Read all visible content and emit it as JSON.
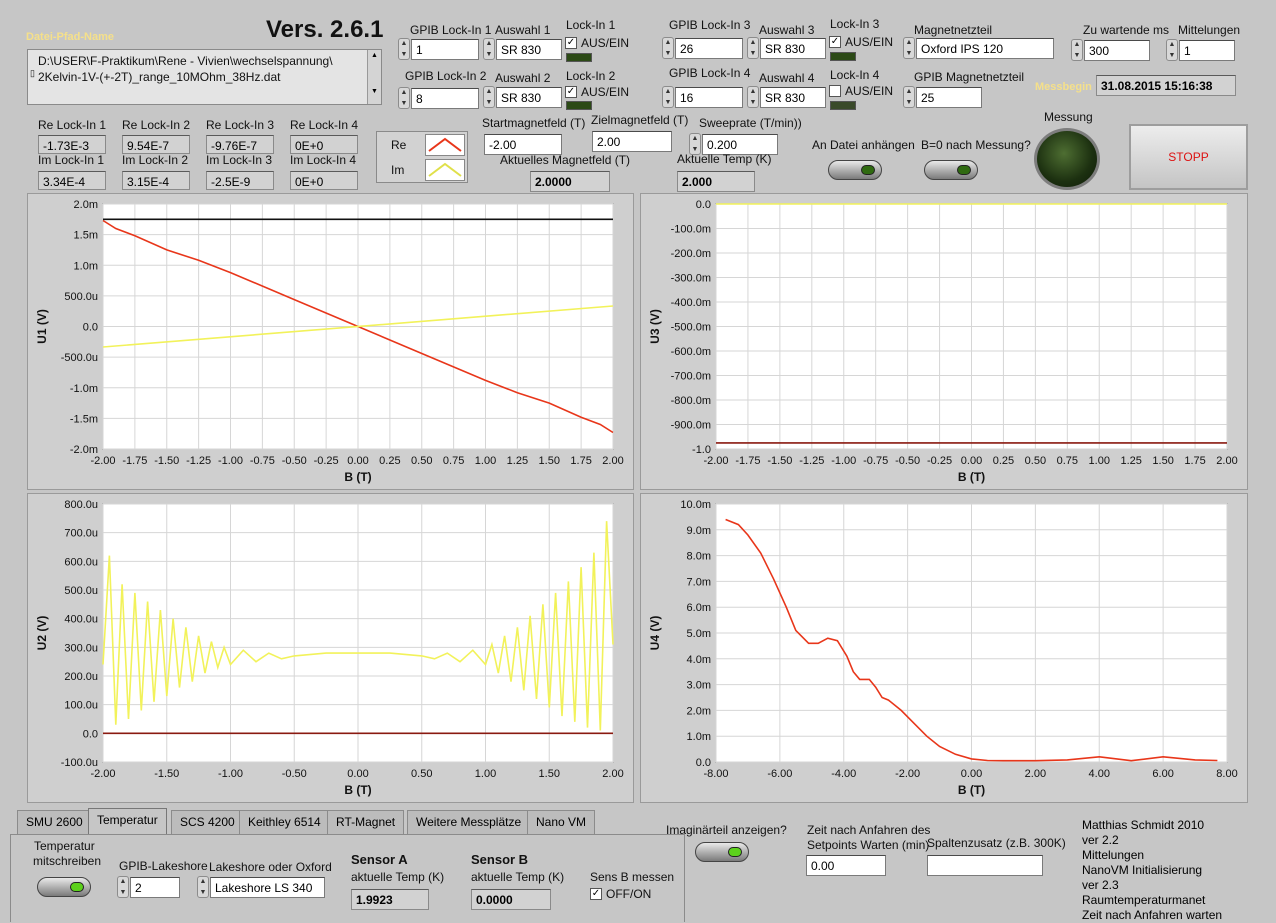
{
  "header": {
    "file_path_label": "Datei-Pfad-Name",
    "version": "Vers. 2.6.1",
    "file_path_line1": "D:\\USER\\F-Praktikum\\Rene - Vivien\\wechselspannung\\",
    "file_path_line2": "2Kelvin-1V-(+-2T)_range_10MOhm_38Hz.dat"
  },
  "lockins": [
    {
      "gpib_label": "GPIB Lock-In 1",
      "gpib": "1",
      "auswahl_label": "Auswahl 1",
      "auswahl": "SR 830",
      "switch_label": "Lock-In 1",
      "switch_text": "AUS/EIN",
      "checked": true
    },
    {
      "gpib_label": "GPIB Lock-In 2",
      "gpib": "8",
      "auswahl_label": "Auswahl 2",
      "auswahl": "SR 830",
      "switch_label": "Lock-In 2",
      "switch_text": "AUS/EIN",
      "checked": true
    },
    {
      "gpib_label": "GPIB Lock-In 3",
      "gpib": "26",
      "auswahl_label": "Auswahl 3",
      "auswahl": "SR 830",
      "switch_label": "Lock-In 3",
      "switch_text": "AUS/EIN",
      "checked": true
    },
    {
      "gpib_label": "GPIB Lock-In 4",
      "gpib": "16",
      "auswahl_label": "Auswahl 4",
      "auswahl": "SR 830",
      "switch_label": "Lock-In 4",
      "switch_text": "AUS/EIN",
      "checked": false
    }
  ],
  "magnet": {
    "netzteil_label": "Magnetnetzteil",
    "netzteil": "Oxford IPS 120",
    "gpib_label": "GPIB Magnetnetzteil",
    "gpib": "25",
    "wait_label": "Zu wartende ms",
    "wait": "300",
    "mittel_label": "Mittelungen",
    "mittel": "1",
    "messbeginn_label": "Messbegin",
    "messbeginn": "31.08.2015 15:16:38",
    "start_label": "Startmagnetfeld (T)",
    "start": "-2.00",
    "ziel_label": "Zielmagnetfeld (T)",
    "ziel": "2.00",
    "sweep_label": "Sweeprate (T/min))",
    "sweep": "0.200",
    "aktuell_label": "Aktuelles Magnetfeld (T)",
    "aktuell": "2.0000",
    "temp_label": "Aktuelle Temp (K)",
    "temp": "2.000"
  },
  "readouts": [
    {
      "re_label": "Re Lock-In 1",
      "re": "-1.73E-3",
      "im_label": "Im Lock-In 1",
      "im": "3.34E-4"
    },
    {
      "re_label": "Re Lock-In 2",
      "re": "9.54E-7",
      "im_label": "Im Lock-In 2",
      "im": "3.15E-4"
    },
    {
      "re_label": "Re Lock-In 3",
      "re": "-9.76E-7",
      "im_label": "Im Lock-In 3",
      "im": "-2.5E-9"
    },
    {
      "re_label": "Re Lock-In 4",
      "re": "0E+0",
      "im_label": "Im Lock-In 4",
      "im": "0E+0"
    }
  ],
  "legend": {
    "re": "Re",
    "im": "Im",
    "re_color": "#e8361a",
    "im_color": "#f2f25a"
  },
  "controls": {
    "anhaengen_label": "An Datei anhängen",
    "bnull_label": "B=0 nach Messung?",
    "messung_label": "Messung",
    "stopp": "STOPP"
  },
  "chart_data": [
    {
      "type": "line",
      "ylabel": "U1 (V)",
      "xlabel": "B (T)",
      "xlim": [
        -2,
        2
      ],
      "ylim": [
        -0.002,
        0.002
      ],
      "xticks": [
        "-2.00",
        "-1.75",
        "-1.50",
        "-1.25",
        "-1.00",
        "-0.75",
        "-0.50",
        "-0.25",
        "0.00",
        "0.25",
        "0.50",
        "0.75",
        "1.00",
        "1.25",
        "1.50",
        "1.75",
        "2.00"
      ],
      "yticks": [
        "-2.0m",
        "-1.5m",
        "-1.0m",
        "-500.0u",
        "0.0",
        "500.0u",
        "1.0m",
        "1.5m",
        "2.0m"
      ],
      "series": [
        {
          "color": "#e8361a",
          "x": [
            -2.0,
            -1.9,
            -1.75,
            -1.5,
            -1.25,
            -1.0,
            -0.5,
            0.0,
            0.5,
            1.0,
            1.25,
            1.5,
            1.75,
            1.9,
            2.0
          ],
          "y": [
            0.00173,
            0.0016,
            0.00148,
            0.00125,
            0.00108,
            0.00088,
            0.00044,
            0.0,
            -0.00044,
            -0.00088,
            -0.00108,
            -0.00125,
            -0.00148,
            -0.0016,
            -0.00173
          ]
        },
        {
          "color": "#f2f25a",
          "x": [
            -2.0,
            2.0
          ],
          "y": [
            -0.000334,
            0.000334
          ]
        },
        {
          "color": "#111111",
          "x": [
            -2.0,
            2.0
          ],
          "y": [
            0.00175,
            0.00175
          ]
        }
      ]
    },
    {
      "type": "line",
      "ylabel": "U3 (V)",
      "xlabel": "B (T)",
      "xlim": [
        -2,
        2
      ],
      "ylim": [
        -1.0,
        0.0
      ],
      "xticks": [
        "-2.00",
        "-1.75",
        "-1.50",
        "-1.25",
        "-1.00",
        "-0.75",
        "-0.50",
        "-0.25",
        "0.00",
        "0.25",
        "0.50",
        "0.75",
        "1.00",
        "1.25",
        "1.50",
        "1.75",
        "2.00"
      ],
      "yticks": [
        "-1.0",
        "-900.0m",
        "-800.0m",
        "-700.0m",
        "-600.0m",
        "-500.0m",
        "-400.0m",
        "-300.0m",
        "-200.0m",
        "-100.0m",
        "0.0"
      ],
      "series": [
        {
          "color": "#f2f25a",
          "x": [
            -2.0,
            2.0
          ],
          "y": [
            0.0,
            0.0
          ]
        },
        {
          "color": "#8a1a10",
          "x": [
            -2.0,
            2.0
          ],
          "y": [
            -0.975,
            -0.975
          ]
        }
      ]
    },
    {
      "type": "line",
      "ylabel": "U2 (V)",
      "xlabel": "B (T)",
      "xlim": [
        -2,
        2
      ],
      "ylim": [
        -0.0001,
        0.0008
      ],
      "xticks": [
        "-2.00",
        "-1.50",
        "-1.00",
        "-0.50",
        "0.00",
        "0.50",
        "1.00",
        "1.50",
        "2.00"
      ],
      "yticks": [
        "-100.0u",
        "0.0",
        "100.0u",
        "200.0u",
        "300.0u",
        "400.0u",
        "500.0u",
        "600.0u",
        "700.0u",
        "800.0u"
      ],
      "series": [
        {
          "color": "#f2f25a",
          "x": [
            -2.0,
            -1.95,
            -1.9,
            -1.85,
            -1.8,
            -1.75,
            -1.7,
            -1.65,
            -1.6,
            -1.55,
            -1.5,
            -1.45,
            -1.4,
            -1.35,
            -1.3,
            -1.25,
            -1.2,
            -1.15,
            -1.1,
            -1.05,
            -1.0,
            -0.9,
            -0.8,
            -0.7,
            -0.6,
            -0.5,
            -0.25,
            0.0,
            0.25,
            0.5,
            0.6,
            0.7,
            0.8,
            0.9,
            1.0,
            1.05,
            1.1,
            1.15,
            1.2,
            1.25,
            1.3,
            1.35,
            1.4,
            1.45,
            1.5,
            1.55,
            1.6,
            1.65,
            1.7,
            1.75,
            1.8,
            1.85,
            1.9,
            1.95,
            2.0
          ],
          "y": [
            0.00024,
            0.00062,
            3e-05,
            0.00052,
            5e-05,
            0.00049,
            8e-05,
            0.00046,
            0.00011,
            0.00043,
            0.00013,
            0.0004,
            0.00016,
            0.00037,
            0.00018,
            0.00034,
            0.00021,
            0.00032,
            0.00023,
            0.0003,
            0.00024,
            0.00029,
            0.00025,
            0.00028,
            0.00026,
            0.00027,
            0.00028,
            0.00028,
            0.00028,
            0.00027,
            0.00026,
            0.00028,
            0.00025,
            0.00029,
            0.00024,
            0.00031,
            0.00021,
            0.00034,
            0.00018,
            0.00037,
            0.00015,
            0.00041,
            0.00012,
            0.00045,
            9e-05,
            0.00049,
            6e-05,
            0.00053,
            4e-05,
            0.00058,
            2e-05,
            0.00063,
            1e-05,
            0.00074,
            0.00031
          ]
        },
        {
          "color": "#8a1a10",
          "x": [
            -2.0,
            2.0
          ],
          "y": [
            0.0,
            0.0
          ]
        }
      ]
    },
    {
      "type": "line",
      "ylabel": "U4 (V)",
      "xlabel": "B (T)",
      "xlim": [
        -8,
        8
      ],
      "ylim": [
        0,
        0.01
      ],
      "xticks": [
        "-8.00",
        "-6.00",
        "-4.00",
        "-2.00",
        "0.00",
        "2.00",
        "4.00",
        "6.00",
        "8.00"
      ],
      "yticks": [
        "0.0",
        "1.0m",
        "2.0m",
        "3.0m",
        "4.0m",
        "5.0m",
        "6.0m",
        "7.0m",
        "8.0m",
        "9.0m",
        "10.0m"
      ],
      "series": [
        {
          "color": "#e8361a",
          "x": [
            -7.7,
            -7.3,
            -7.0,
            -6.6,
            -6.2,
            -5.8,
            -5.5,
            -5.1,
            -4.8,
            -4.5,
            -4.2,
            -3.9,
            -3.7,
            -3.5,
            -3.2,
            -3.0,
            -2.8,
            -2.6,
            -2.2,
            -1.8,
            -1.4,
            -1.0,
            -0.5,
            0.0,
            0.5,
            1.0,
            2.0,
            3.0,
            4.0,
            5.0,
            6.0,
            7.0,
            7.7
          ],
          "y": [
            0.0094,
            0.0092,
            0.0088,
            0.0081,
            0.0071,
            0.006,
            0.0051,
            0.0046,
            0.0046,
            0.0048,
            0.0047,
            0.0041,
            0.0035,
            0.0032,
            0.0032,
            0.0029,
            0.0025,
            0.0024,
            0.002,
            0.0015,
            0.001,
            0.0006,
            0.0003,
            0.00012,
            6e-05,
            5e-05,
            5e-05,
            8e-05,
            0.0002,
            5e-05,
            0.0002,
            8e-05,
            6e-05
          ]
        }
      ]
    }
  ],
  "tabs": [
    "SMU 2600",
    "Temperatur",
    "SCS 4200",
    "Keithley 6514",
    "RT-Magnet",
    "Weitere Messplätze",
    "Nano VM"
  ],
  "temp_panel": {
    "mitschreiben_line1": "Temperatur",
    "mitschreiben_line2": "mitschreiben",
    "lakeshore_gpib_label": "GPIB-Lakeshore",
    "lakeshore_gpib": "2",
    "lakeshore_type_label": "Lakeshore oder Oxford",
    "lakeshore_type": "Lakeshore LS 340",
    "sensor_a": "Sensor A",
    "sensor_a_label": "aktuelle Temp (K)",
    "sensor_a_val": "1.9923",
    "sensor_b": "Sensor B",
    "sensor_b_label": "aktuelle Temp (K)",
    "sensor_b_val": "0.0000",
    "sens_b_label": "Sens B messen",
    "sens_b_text": "OFF/ON"
  },
  "bottom": {
    "imag_label": "Imaginärteil anzeigen?",
    "zeit_label_line1": "Zeit nach Anfahren des",
    "zeit_label_line2": "Setpoints Warten (min)",
    "zeit_val": "0.00",
    "spalten_label": "Spaltenzusatz (z.B. 300K)",
    "spalten_val": "",
    "credits": [
      "Matthias Schmidt 2010",
      "ver 2.2",
      "Mittelungen",
      "NanoVM Initialisierung",
      "ver 2.3",
      "Raumtemperaturmanet",
      "Zeit nach Anfahren warten"
    ]
  }
}
